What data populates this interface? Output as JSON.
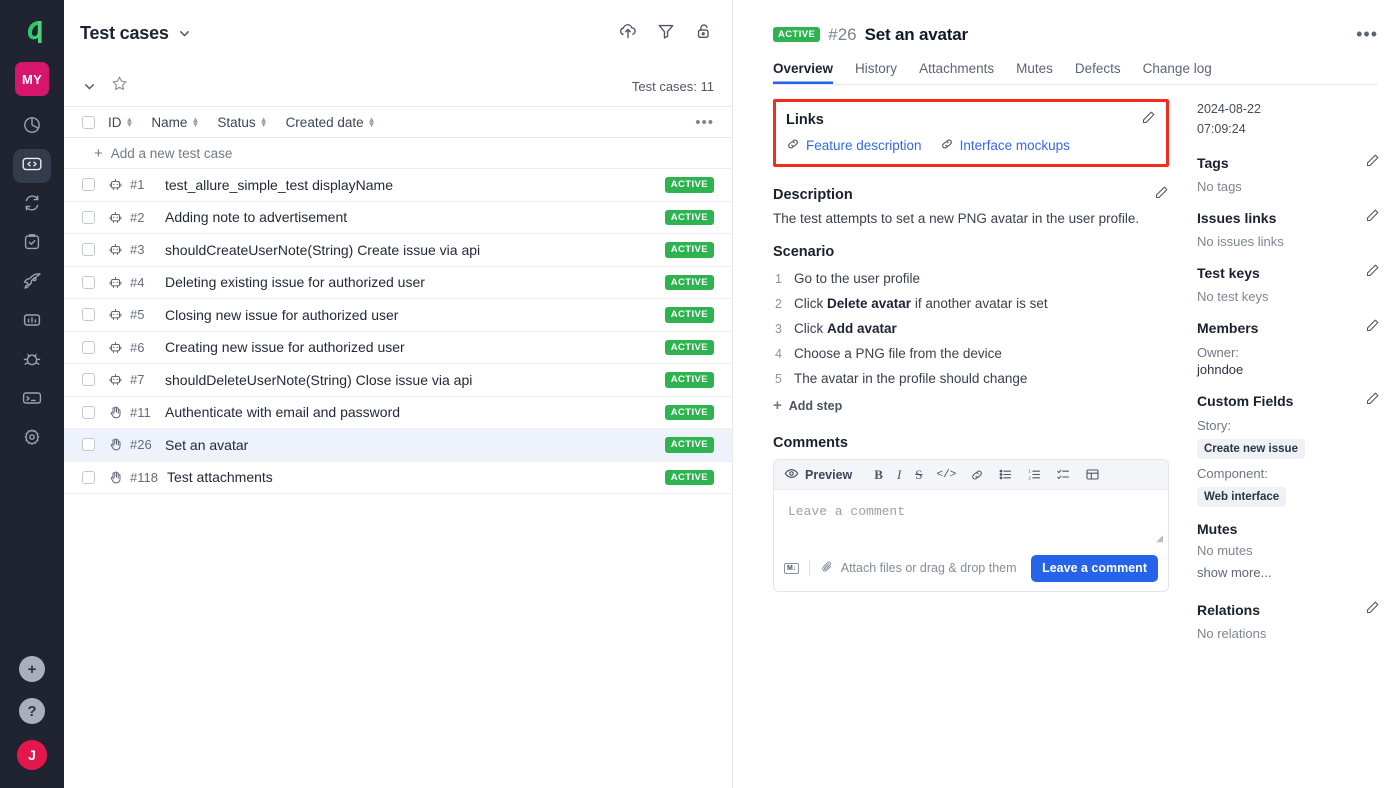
{
  "rail": {
    "logo_icon": "allure-logo-icon",
    "project_badge": "MY",
    "items": [
      {
        "icon": "dashboard-pie-icon",
        "name": "dashboards",
        "active": false
      },
      {
        "icon": "code-brackets-icon",
        "name": "test-cases",
        "active": true
      },
      {
        "icon": "repeat-sync-icon",
        "name": "test-runs",
        "active": false
      },
      {
        "icon": "clipboard-check-icon",
        "name": "test-plans",
        "active": false
      },
      {
        "icon": "rocket-icon",
        "name": "launches",
        "active": false
      },
      {
        "icon": "bar-chart-icon",
        "name": "analytics",
        "active": false
      },
      {
        "icon": "bug-icon",
        "name": "defects",
        "active": false
      },
      {
        "icon": "terminal-icon",
        "name": "console",
        "active": false
      },
      {
        "icon": "gear-icon",
        "name": "settings",
        "active": false
      }
    ],
    "bottom": [
      {
        "icon": "plus-circle-icon",
        "name": "add",
        "glyph": "+"
      },
      {
        "icon": "question-circle-icon",
        "name": "help",
        "glyph": "?"
      }
    ],
    "user_initial": "J"
  },
  "list": {
    "title": "Test cases",
    "title_chevron_icon": "chevron-down-icon",
    "actions": [
      {
        "icon": "upload-cloud-icon",
        "name": "import"
      },
      {
        "icon": "filter-icon",
        "name": "filter"
      },
      {
        "icon": "unlock-icon",
        "name": "lock-toggle"
      }
    ],
    "subbar": {
      "collapse_icon": "chevron-down-icon",
      "favorite_icon": "star-icon",
      "count_label": "Test cases: 11"
    },
    "columns": [
      "ID",
      "Name",
      "Status",
      "Created date"
    ],
    "more_icon": "ellipsis-icon",
    "add_row_label": "Add a new test case",
    "rows": [
      {
        "id": "#1",
        "name": "test_allure_simple_test displayName",
        "status": "ACTIVE",
        "type": "automated",
        "selected": false
      },
      {
        "id": "#2",
        "name": "Adding note to advertisement",
        "status": "ACTIVE",
        "type": "automated",
        "selected": false
      },
      {
        "id": "#3",
        "name": "shouldCreateUserNote(String) Create issue via api",
        "status": "ACTIVE",
        "type": "automated",
        "selected": false
      },
      {
        "id": "#4",
        "name": "Deleting existing issue for authorized user",
        "status": "ACTIVE",
        "type": "automated",
        "selected": false
      },
      {
        "id": "#5",
        "name": "Closing new issue for authorized user",
        "status": "ACTIVE",
        "type": "automated",
        "selected": false
      },
      {
        "id": "#6",
        "name": "Creating new issue for authorized user",
        "status": "ACTIVE",
        "type": "automated",
        "selected": false
      },
      {
        "id": "#7",
        "name": "shouldDeleteUserNote(String) Close issue via api",
        "status": "ACTIVE",
        "type": "automated",
        "selected": false
      },
      {
        "id": "#11",
        "name": "Authenticate with email and password",
        "status": "ACTIVE",
        "type": "manual",
        "selected": false
      },
      {
        "id": "#26",
        "name": "Set an avatar",
        "status": "ACTIVE",
        "type": "manual",
        "selected": true
      },
      {
        "id": "#118",
        "name": "Test attachments",
        "status": "ACTIVE",
        "type": "manual",
        "selected": false
      }
    ]
  },
  "detail": {
    "status_badge": "ACTIVE",
    "case_id": "#26",
    "case_title": "Set an avatar",
    "more_icon": "ellipsis-icon",
    "tabs": [
      {
        "label": "Overview",
        "active": true
      },
      {
        "label": "History",
        "active": false
      },
      {
        "label": "Attachments",
        "active": false
      },
      {
        "label": "Mutes",
        "active": false
      },
      {
        "label": "Defects",
        "active": false
      },
      {
        "label": "Change log",
        "active": false
      }
    ],
    "links": {
      "title": "Links",
      "edit_icon": "pencil-icon",
      "highlighted": true,
      "highlight_color": "#f42c1e",
      "items": [
        {
          "label": "Feature description",
          "icon": "link-chain-icon"
        },
        {
          "label": "Interface mockups",
          "icon": "link-chain-icon"
        }
      ]
    },
    "description": {
      "title": "Description",
      "edit_icon": "pencil-icon",
      "text": "The test attempts to set a new PNG avatar in the user profile."
    },
    "scenario": {
      "title": "Scenario",
      "steps": [
        {
          "no": "1",
          "text": "Go to the user profile",
          "bold": ""
        },
        {
          "no": "2",
          "text_before": "Click ",
          "bold": "Delete avatar",
          "text_after": " if another avatar is set"
        },
        {
          "no": "3",
          "text_before": "Click ",
          "bold": "Add avatar",
          "text_after": ""
        },
        {
          "no": "4",
          "text": "Choose a PNG file from the device",
          "bold": ""
        },
        {
          "no": "5",
          "text": "The avatar in the profile should change",
          "bold": ""
        }
      ],
      "add_step_label": "Add step",
      "add_step_icon": "plus-icon"
    },
    "comments": {
      "title": "Comments",
      "preview_label": "Preview",
      "preview_icon": "eye-icon",
      "tools": [
        {
          "icon": "bold-icon",
          "glyph": "B"
        },
        {
          "icon": "italic-icon",
          "glyph": "I"
        },
        {
          "icon": "strikethrough-icon",
          "glyph": "S"
        },
        {
          "icon": "code-icon",
          "glyph": "</>"
        },
        {
          "icon": "link-icon",
          "glyph": ""
        },
        {
          "icon": "bullet-list-icon",
          "glyph": ""
        },
        {
          "icon": "numbered-list-icon",
          "glyph": ""
        },
        {
          "icon": "checklist-icon",
          "glyph": ""
        },
        {
          "icon": "table-icon",
          "glyph": ""
        }
      ],
      "placeholder": "Leave a comment",
      "value": "",
      "markdown_chip": "M↓",
      "attach_icon": "paperclip-icon",
      "attach_label": "Attach files or drag & drop them",
      "submit_label": "Leave a comment",
      "submit_color": "#2563eb"
    },
    "meta": {
      "created_date": "2024-08-22",
      "created_time": "07:09:24",
      "sections": [
        {
          "title": "Tags",
          "empty": "No tags",
          "editable": true
        },
        {
          "title": "Issues links",
          "empty": "No issues links",
          "editable": true
        },
        {
          "title": "Test keys",
          "empty": "No test keys",
          "editable": true
        }
      ],
      "members": {
        "title": "Members",
        "editable": true,
        "owner_label": "Owner:",
        "owner_value": "johndoe"
      },
      "custom_fields": {
        "title": "Custom Fields",
        "editable": true,
        "fields": [
          {
            "label": "Story:",
            "value": "Create new issue"
          },
          {
            "label": "Component:",
            "value": "Web interface"
          }
        ]
      },
      "mutes": {
        "title": "Mutes",
        "empty": "No mutes",
        "show_more": "show more...",
        "editable": false
      },
      "relations": {
        "title": "Relations",
        "empty": "No relations",
        "editable": true
      }
    }
  }
}
